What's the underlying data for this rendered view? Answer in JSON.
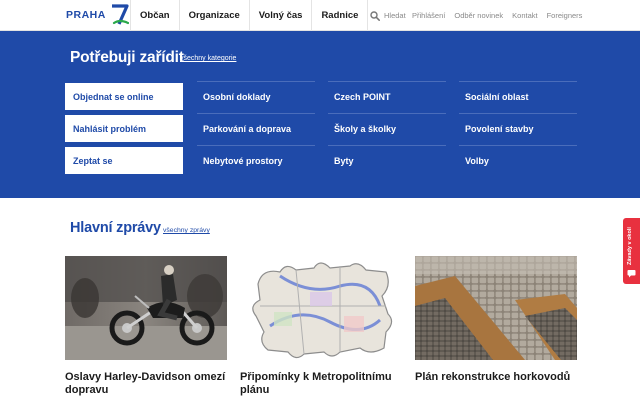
{
  "header": {
    "logo_text": "PRAHA",
    "logo_numeral": "7",
    "nav": [
      "Občan",
      "Organizace",
      "Volný čas",
      "Radnice"
    ],
    "search_label": "Hledat",
    "util_links": [
      "Přihlášení",
      "Odběr novinek",
      "Kontakt",
      "Foreigners"
    ]
  },
  "panel": {
    "title": "Potřebuji zařídit",
    "all_categories_link": "všechny kategorie",
    "actions": [
      "Objednat se online",
      "Nahlásit problém",
      "Zeptat se"
    ],
    "categories": [
      "Osobní doklady",
      "Czech POINT",
      "Sociální oblast",
      "Parkování a doprava",
      "Školy a školky",
      "Povolení stavby",
      "Nebytové prostory",
      "Byty",
      "Volby"
    ]
  },
  "side_tab": {
    "label": "Závady v okolí"
  },
  "news": {
    "title": "Hlavní zprávy",
    "all_news_link": "všechny zprávy",
    "items": [
      {
        "caption": "Oslavy Harley-Davidson omezí dopravu"
      },
      {
        "caption": "Připomínky k Metropolitnímu plánu"
      },
      {
        "caption": "Plán rekonstrukce horkovodů"
      }
    ]
  },
  "colors": {
    "brand_blue": "#1f4aa8",
    "brand_green": "#2aa84a",
    "side_tab_red": "#e8313f"
  }
}
